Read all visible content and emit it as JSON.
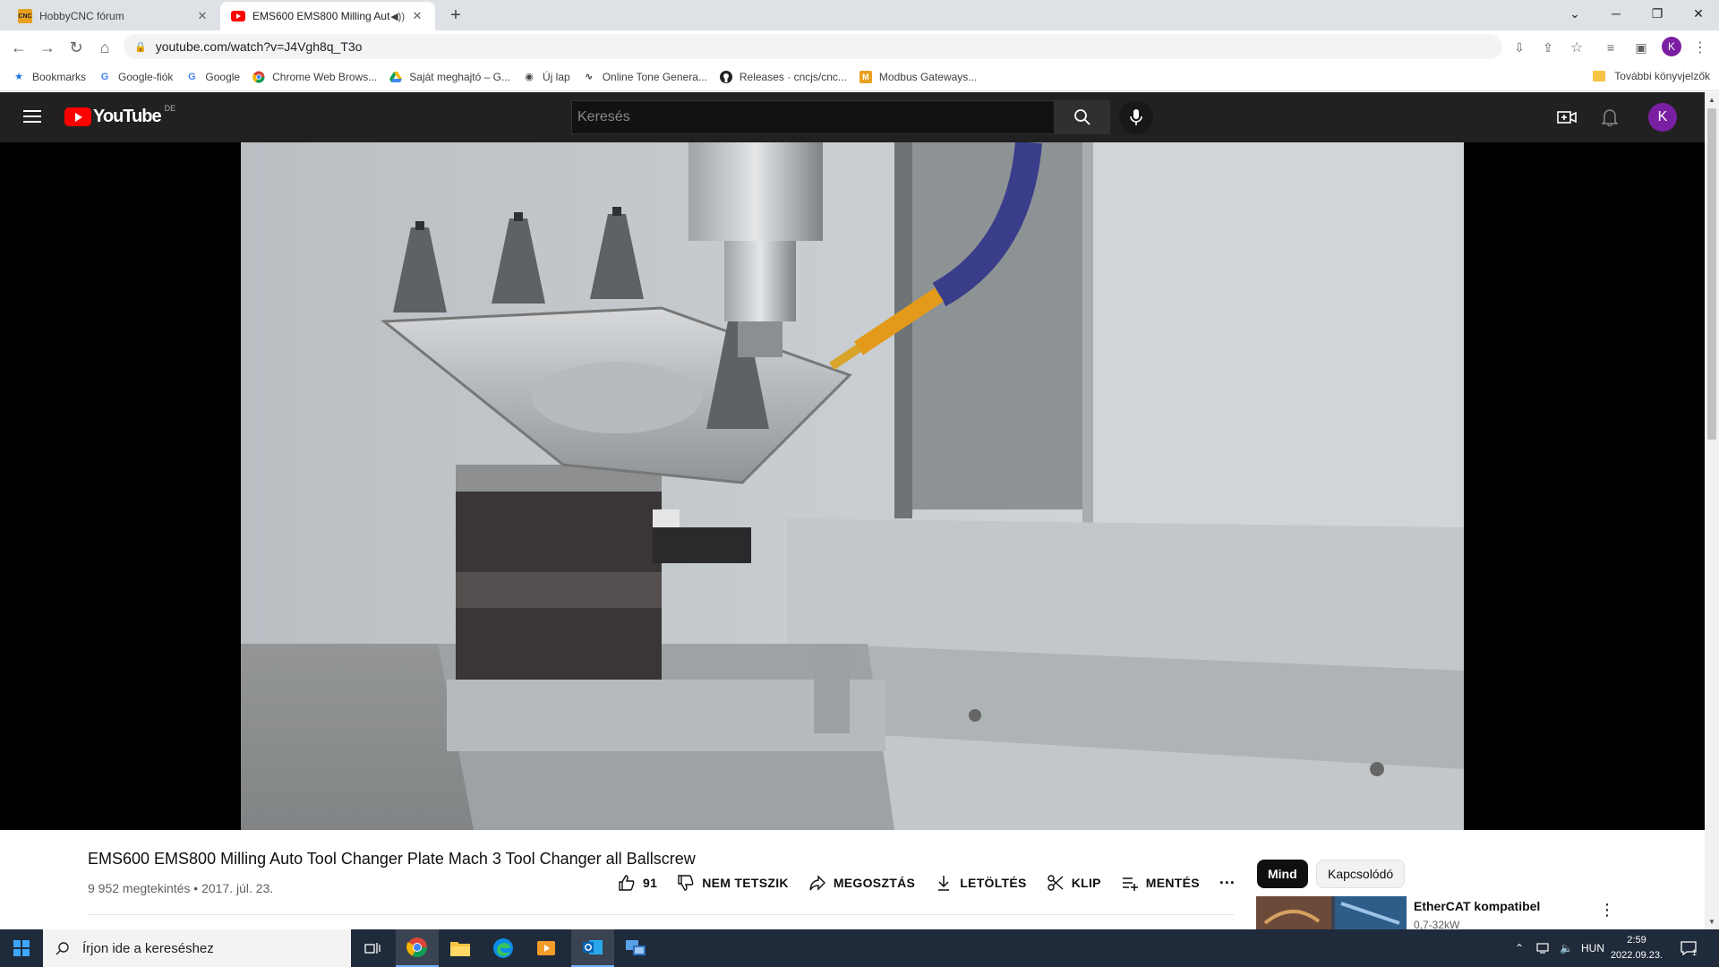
{
  "browser": {
    "tabs": [
      {
        "title": "HobbyCNC fórum",
        "favicon": "hobbycnc-icon"
      },
      {
        "title": "EMS600 EMS800 Milling Auto Tool Changer Plate Mach 3 Tool Changer all Ballscrew",
        "favicon": "youtube-icon"
      }
    ],
    "url": "youtube.com/watch?v=J4Vgh8q_T3o",
    "profile_initial": "K"
  },
  "bookmarks": {
    "items": [
      {
        "label": "Bookmarks",
        "icon": "star-icon"
      },
      {
        "label": "Google-fiók",
        "icon": "google-icon"
      },
      {
        "label": "Google",
        "icon": "google-icon"
      },
      {
        "label": "Chrome Web Brows...",
        "icon": "chrome-web-store-icon"
      },
      {
        "label": "Saját meghajtó – G...",
        "icon": "drive-icon"
      },
      {
        "label": "Új lap",
        "icon": "globe-icon"
      },
      {
        "label": "Online Tone Genera...",
        "icon": "wave-icon"
      },
      {
        "label": "Releases · cncjs/cnc...",
        "icon": "github-icon"
      },
      {
        "label": "Modbus Gateways...",
        "icon": "modbus-icon"
      }
    ],
    "other": "További könyvjelzők"
  },
  "youtube": {
    "logo_text": "YouTube",
    "country_code": "DE",
    "search_placeholder": "Keresés",
    "avatar_initial": "K"
  },
  "video": {
    "title": "EMS600 EMS800 Milling Auto Tool Changer Plate Mach 3 Tool Changer all Ballscrew",
    "meta": "9 952 megtekintés • 2017. júl. 23.",
    "likes": "91",
    "actions": {
      "dislike": "NEM TETSZIK",
      "share": "MEGOSZTÁS",
      "download": "LETÖLTÉS",
      "clip": "KLIP",
      "save": "MENTÉS",
      "more": "..."
    }
  },
  "related": {
    "chips": [
      "Mind",
      "Kapcsolódó"
    ],
    "first": {
      "title": "EtherCAT kompatibel",
      "subtitle": "0,7-32kW"
    }
  },
  "taskbar": {
    "search_placeholder": "Írjon ide a kereséshez",
    "language": "HUN",
    "time": "2:59",
    "date": "2022.09.23.",
    "notification_count": "1"
  }
}
